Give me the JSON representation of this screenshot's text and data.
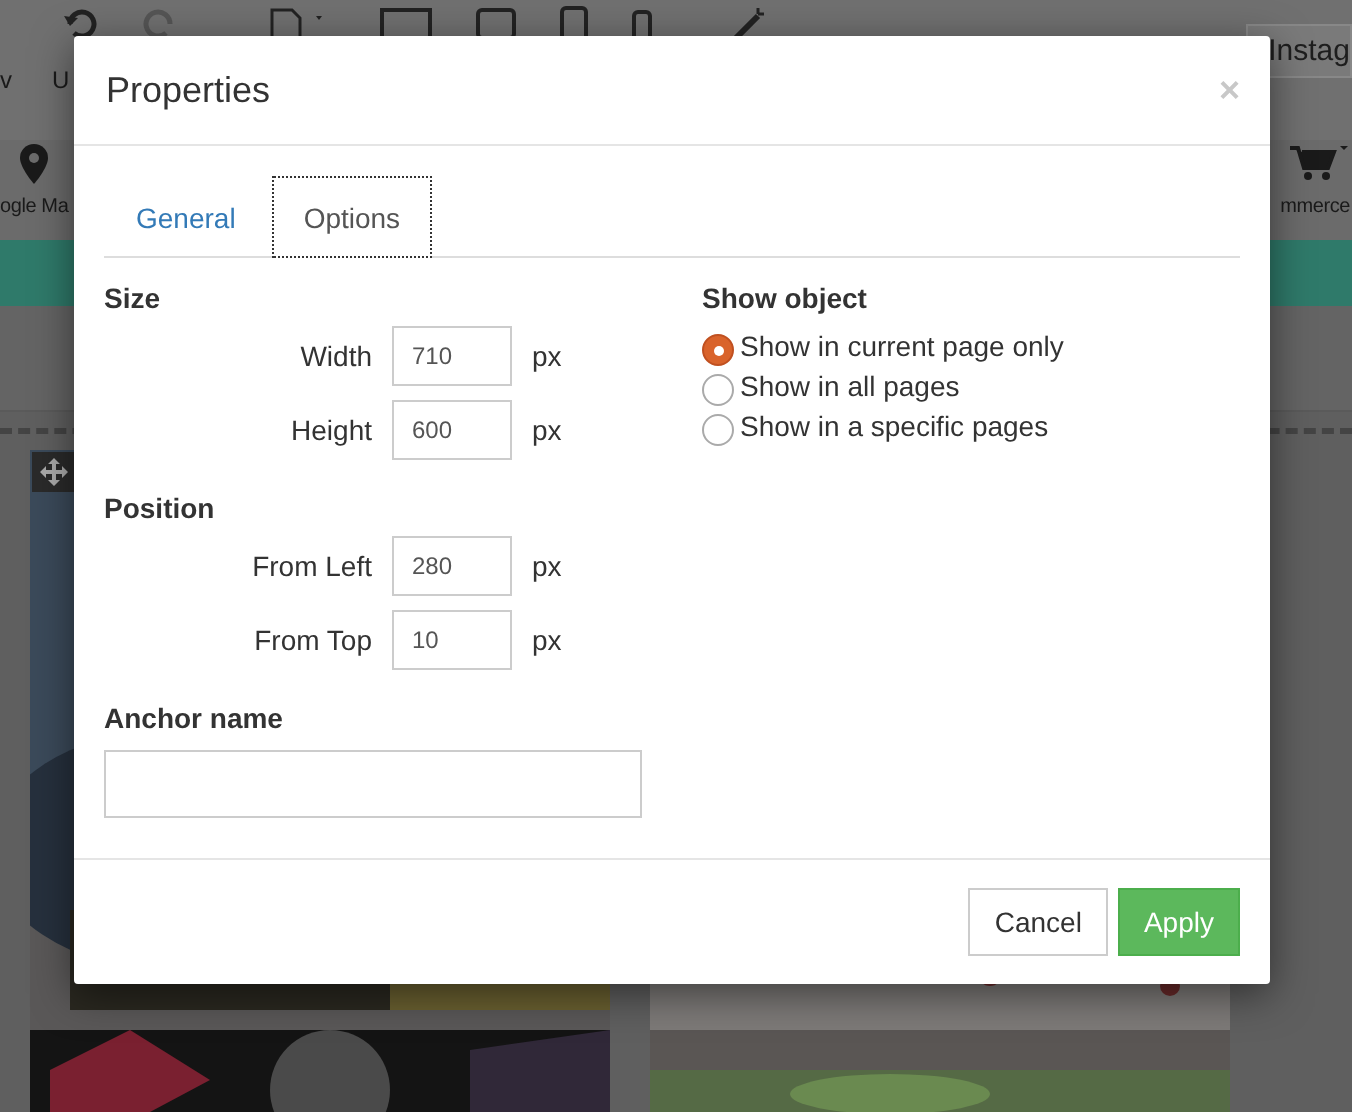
{
  "background": {
    "toolbar_labels": [
      "v",
      "U"
    ],
    "top_right_label": "Instag",
    "left_label": "ogle Ma",
    "right_label": "mmerce"
  },
  "dialog": {
    "title": "Properties",
    "close": "×",
    "tabs": [
      {
        "label": "General",
        "selected": false
      },
      {
        "label": "Options",
        "selected": true
      }
    ],
    "size": {
      "heading": "Size",
      "fields": [
        {
          "label": "Width",
          "value": "710",
          "unit": "px"
        },
        {
          "label": "Height",
          "value": "600",
          "unit": "px"
        }
      ]
    },
    "position": {
      "heading": "Position",
      "fields": [
        {
          "label": "From Left",
          "value": "280",
          "unit": "px"
        },
        {
          "label": "From Top",
          "value": "10",
          "unit": "px"
        }
      ]
    },
    "anchor": {
      "label": "Anchor name"
    },
    "show_object": {
      "heading": "Show object",
      "options": [
        {
          "label": "Show in current page only",
          "selected": true
        },
        {
          "label": "Show in all pages",
          "selected": false
        },
        {
          "label": "Show in a specific pages",
          "selected": false
        }
      ]
    },
    "buttons": [
      {
        "label": "Cancel",
        "kind": "default"
      },
      {
        "label": "Apply",
        "kind": "primary"
      }
    ]
  }
}
